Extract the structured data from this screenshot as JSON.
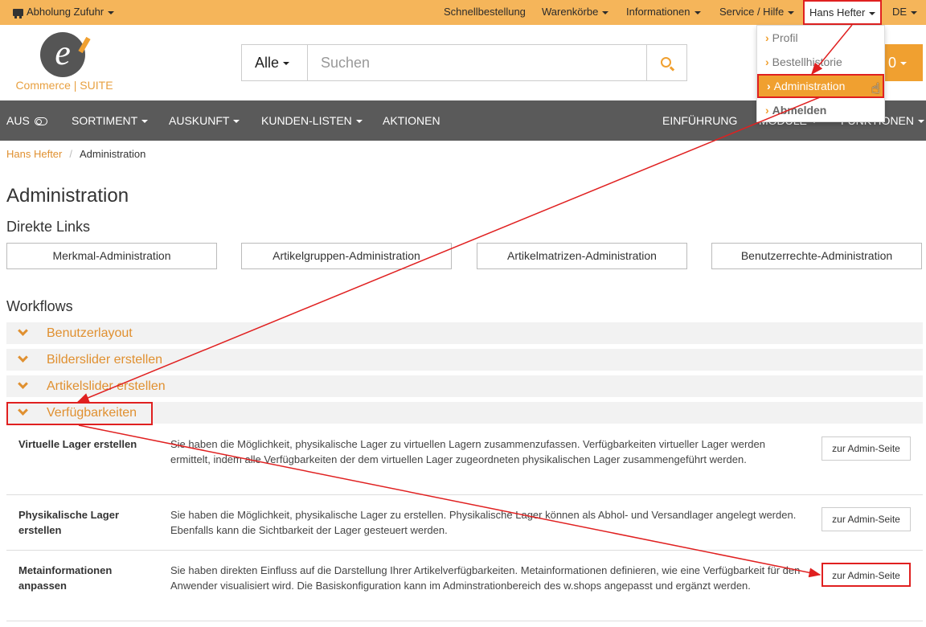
{
  "topbar": {
    "pickup": "Abholung Zufuhr",
    "quick_order": "Schnellbestellung",
    "carts": "Warenkörbe",
    "info": "Informationen",
    "service": "Service / Hilfe",
    "user": "Hans Hefter",
    "language": "DE"
  },
  "logo": {
    "mark": "e",
    "text": "Commerce | SUITE"
  },
  "search": {
    "category": "Alle",
    "placeholder": "Suchen"
  },
  "cart": {
    "count": "0"
  },
  "user_menu": {
    "items": [
      "Profil",
      "Bestellhistorie",
      "Administration",
      "Abmelden"
    ],
    "active": "Administration"
  },
  "nav": {
    "toggle_label": "AUS",
    "items": [
      "SORTIMENT",
      "AUSKUNFT",
      "KUNDEN-LISTEN",
      "AKTIONEN"
    ],
    "right_items": [
      "EINFÜHRUNG",
      "MODULE",
      "FUNKTIONEN"
    ]
  },
  "breadcrumb": {
    "home": "Hans Hefter",
    "current": "Administration"
  },
  "page": {
    "title": "Administration",
    "direct_links_heading": "Direkte Links",
    "direct_links": [
      "Merkmal-Administration",
      "Artikelgruppen-Administration",
      "Artikelmatrizen-Administration",
      "Benutzerrechte-Administration"
    ],
    "workflows_heading": "Workflows",
    "workflows": [
      "Benutzerlayout",
      "Bilderslider erstellen",
      "Artikelslider erstellen",
      "Verfügbarkeiten"
    ],
    "expanded_workflow": "Verfügbarkeiten",
    "rows": [
      {
        "title": "Virtuelle Lager erstellen",
        "desc": "Sie haben die Möglichkeit, physikalische Lager zu virtuellen Lagern zusammenzufassen. Verfügbarkeiten virtueller Lager werden ermittelt, indem alle Verfügbarkeiten der dem virtuellen Lager zugeordneten physikalischen Lager zusammengeführt werden.",
        "button": "zur Admin-Seite"
      },
      {
        "title": "Physikalische Lager erstellen",
        "desc": "Sie haben die Möglichkeit, physikalische Lager zu erstellen. Physikalische Lager können als Abhol- und Versandlager angelegt werden. Ebenfalls kann die Sichtbarkeit der Lager gesteuert werden.",
        "button": "zur Admin-Seite"
      },
      {
        "title": "Metainformationen anpassen",
        "desc": "Sie haben direkten Einfluss auf die Darstellung Ihrer Artikelverfügbarkeiten. Metainformationen definieren, wie eine Verfügbarkeit für den Anwender visualisiert wird. Die Basiskonfiguration kann im Adminstrationbereich des w.shops angepasst und ergänzt werden.",
        "button": "zur Admin-Seite"
      }
    ]
  },
  "colors": {
    "accent": "#f0a030",
    "topbar": "#f5b55a",
    "nav": "#5a5a5a",
    "highlight": "#e02020"
  }
}
